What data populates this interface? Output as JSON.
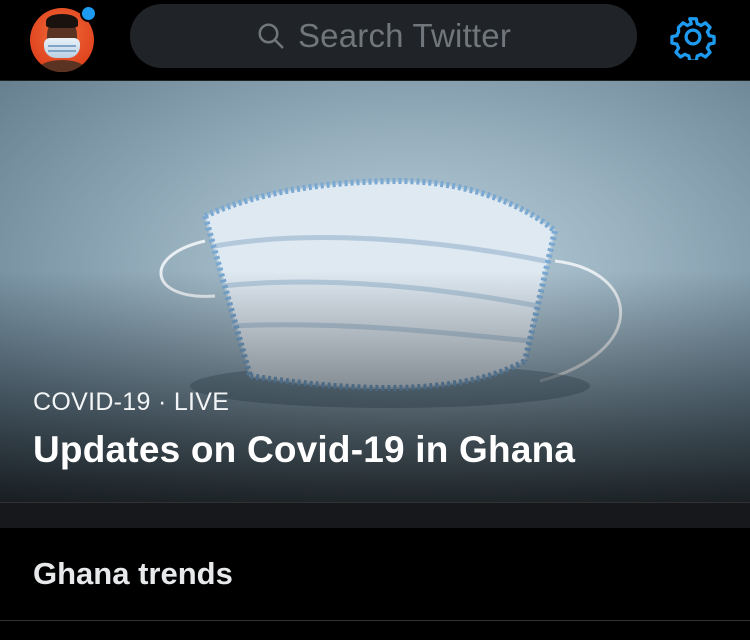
{
  "header": {
    "search_placeholder": "Search Twitter",
    "icons": {
      "search": "search-icon",
      "settings": "gear-icon",
      "avatar": "avatar",
      "notification": "notification-dot"
    },
    "accent_color": "#1d9bf0"
  },
  "hero": {
    "category": "COVID-19",
    "separator": "·",
    "status": "LIVE",
    "meta": "COVID-19 · LIVE",
    "title": "Updates on Covid-19 in Ghana",
    "image": "surgical-mask-photo"
  },
  "trends": {
    "title": "Ghana trends"
  },
  "colors": {
    "background": "#000000",
    "search_bg": "#202327",
    "muted_text": "#71767b",
    "primary_text": "#e7e9ea"
  }
}
